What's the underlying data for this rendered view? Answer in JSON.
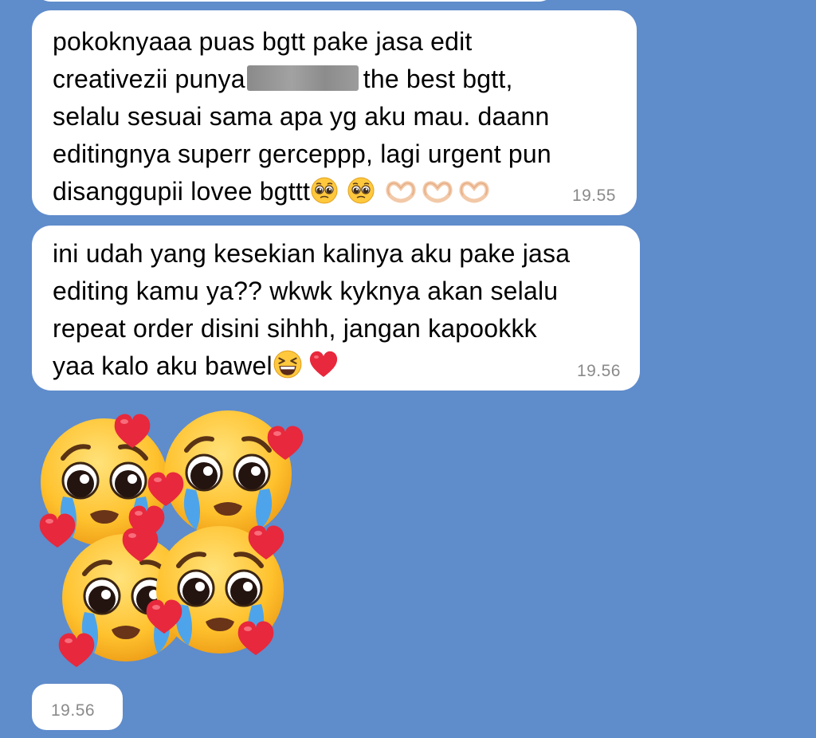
{
  "messages": [
    {
      "text_line1": "pokoknyaaa puas bgtt pake jasa edit",
      "text_line2_before": "creativezii punya",
      "text_line2_after": "the best bgtt,",
      "text_line3": "selalu sesuai sama apa yg aku mau. daann",
      "text_line4": "editingnya superr gerceppp, lagi urgent pun",
      "text_line5": "disanggupii lovee bgttt",
      "emojis": [
        "pleading-face-icon",
        "pleading-face-icon",
        "heart-hands-icon",
        "heart-hands-icon",
        "heart-hands-icon"
      ],
      "time": "19.55"
    },
    {
      "text_line1": "ini udah yang kesekian kalinya aku pake jasa",
      "text_line2": "editing kamu ya?? wkwk kyknya akan selalu",
      "text_line3": "repeat order disini sihhh, jangan kapookkk",
      "text_line4": "yaa kalo aku bawel",
      "emojis": [
        "grinning-squinting-face-icon",
        "red-heart-icon"
      ],
      "time": "19.56"
    },
    {
      "sticker": "crying-faces-with-hearts-sticker",
      "time": "19.56"
    }
  ],
  "colors": {
    "chat_background": "#5f8ccb",
    "bubble": "#ffffff",
    "text": "#000000",
    "time": "#8a8a8a",
    "heart": "#e8283c",
    "emoji_face": "#ffc83d"
  }
}
